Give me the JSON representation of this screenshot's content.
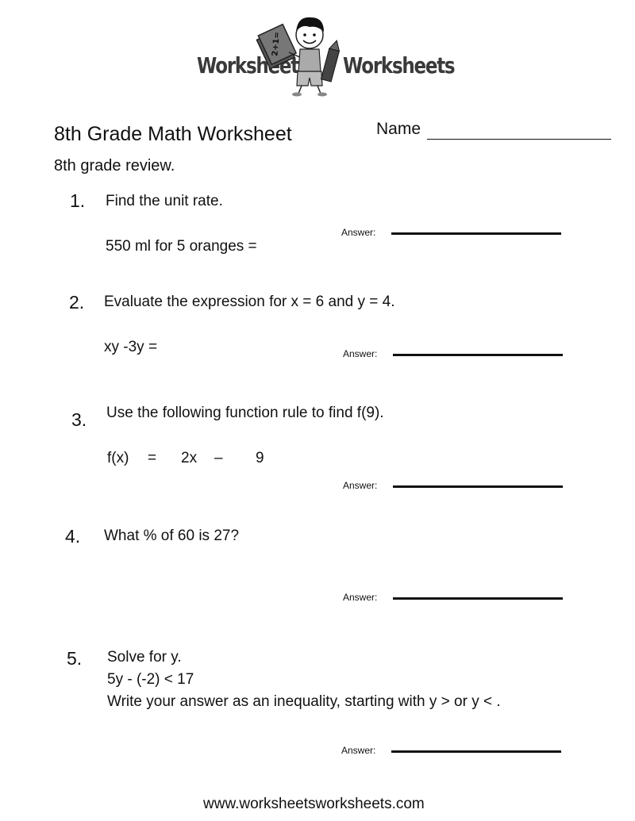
{
  "logo": {
    "left_word": "Worksheets",
    "right_word": "Worksheets",
    "mascot_icon": "boy-with-book-and-pencil-icon",
    "book_text": "2+1="
  },
  "header": {
    "title": "8th Grade Math Worksheet",
    "name_label": "Name",
    "subtitle": "8th grade review."
  },
  "questions": [
    {
      "number": "1.",
      "prompt": "Find the unit rate.",
      "lines": [
        "550 ml for 5 oranges  ="
      ],
      "answer_label": "Answer:"
    },
    {
      "number": "2.",
      "prompt": "Evaluate the expression for x = 6 and y = 4.",
      "lines": [
        "xy -3y ="
      ],
      "answer_label": "Answer:"
    },
    {
      "number": "3.",
      "prompt": "Use the following function rule to find f(9).",
      "lines": [
        "f(x)",
        "=",
        "2x",
        "–",
        "9"
      ],
      "answer_label": "Answer:"
    },
    {
      "number": "4.",
      "prompt": "What % of 60 is  27?",
      "lines": [],
      "answer_label": "Answer:"
    },
    {
      "number": "5.",
      "prompt": "Solve for y.",
      "lines": [
        "5y - (-2) < 17",
        "Write your answer as an inequality, starting with y > or y < ."
      ],
      "answer_label": "Answer:"
    }
  ],
  "footer": {
    "url": "www.worksheetsworksheets.com"
  }
}
